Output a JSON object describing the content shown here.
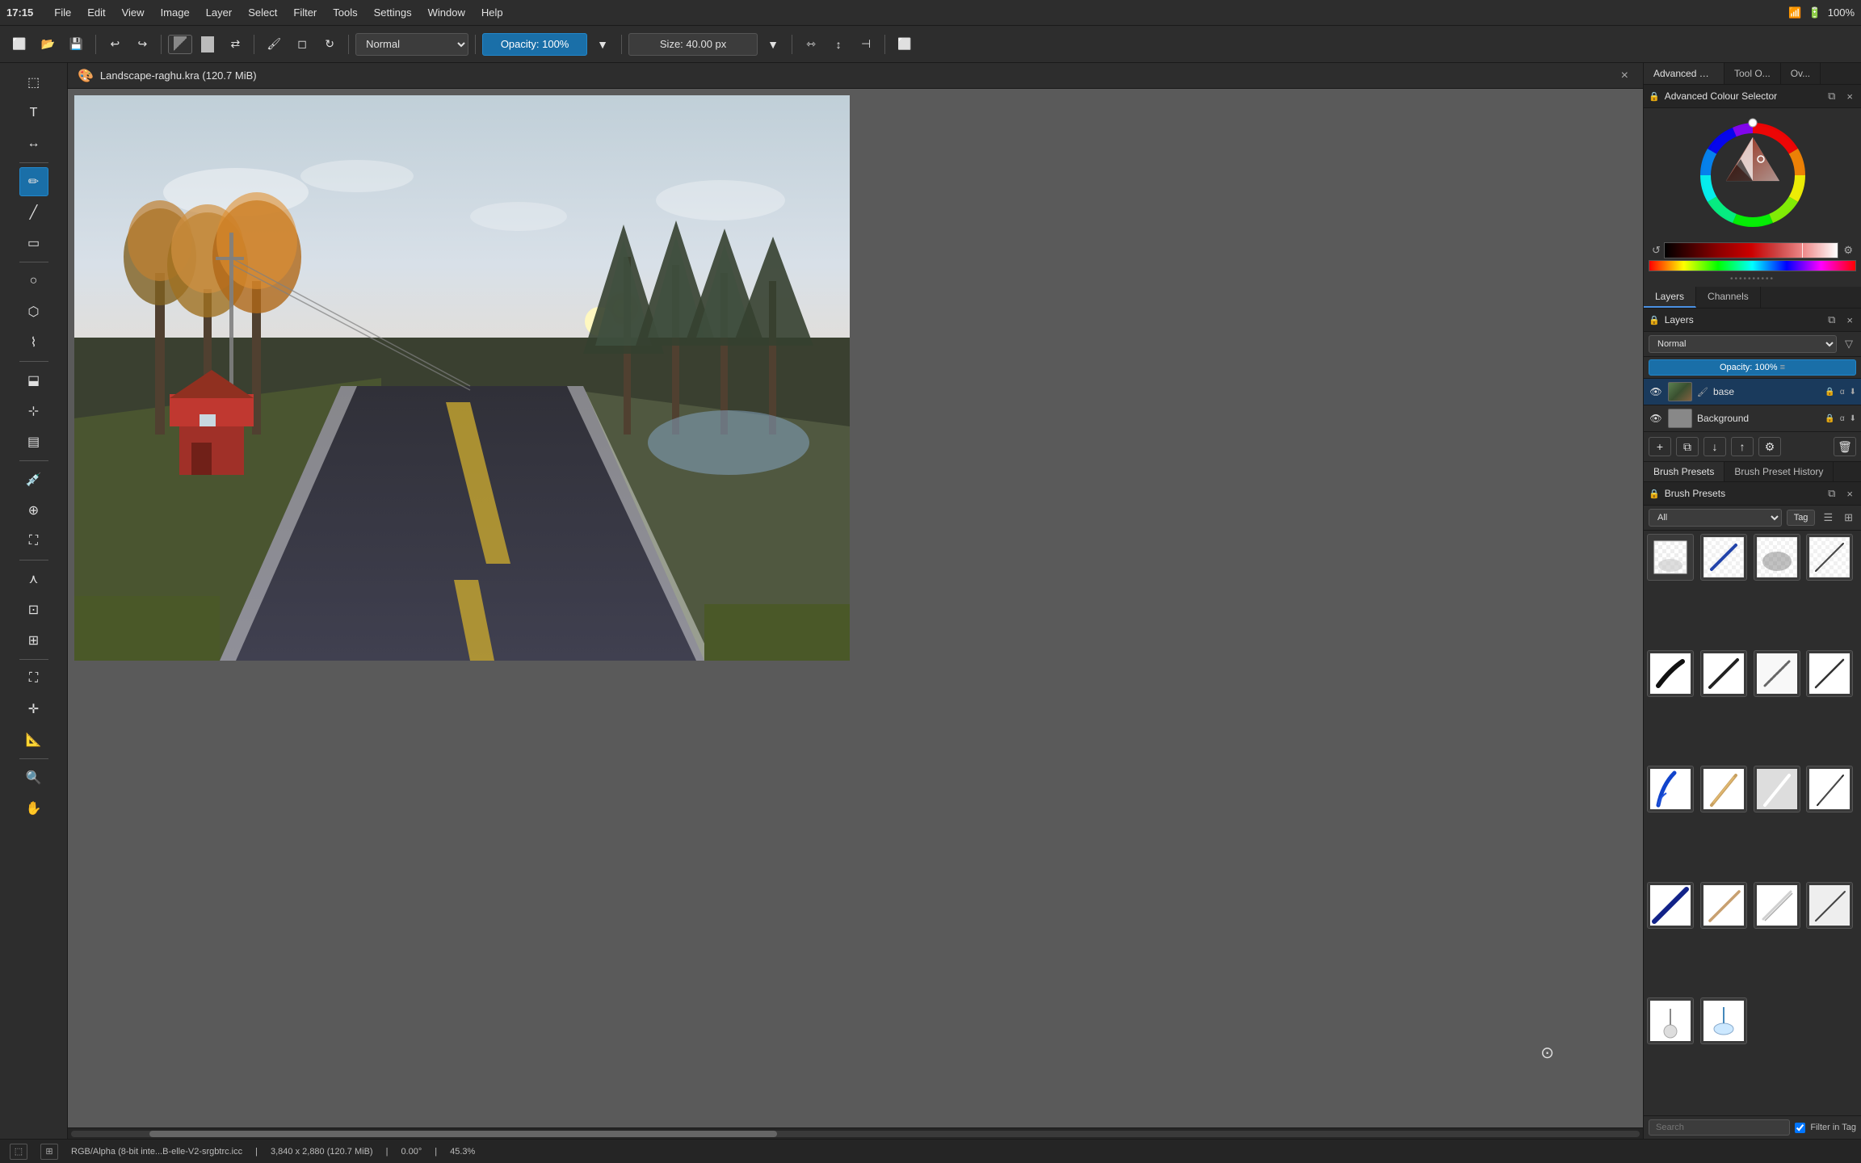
{
  "menubar": {
    "time": "17:15",
    "items": [
      "File",
      "Edit",
      "View",
      "Image",
      "Layer",
      "Select",
      "Filter",
      "Tools",
      "Settings",
      "Window",
      "Help"
    ],
    "battery": "100%"
  },
  "toolbar": {
    "blend_mode": "Normal",
    "opacity_label": "Opacity: 100%",
    "size_label": "Size: 40.00 px"
  },
  "canvas": {
    "title": "Landscape-raghu.kra (120.7 MiB)",
    "close_btn": "×"
  },
  "colour_selector": {
    "title": "Advanced Colour Selector",
    "tab1": "Advanced Colour Se...",
    "tab2": "Tool O...",
    "tab3": "Ov..."
  },
  "layers": {
    "title": "Layers",
    "tab_layers": "Layers",
    "tab_channels": "Channels",
    "blend_mode": "Normal",
    "opacity": "Opacity:  100%",
    "layer1_name": "base",
    "layer2_name": "Background"
  },
  "brush_presets": {
    "title": "Brush Presets",
    "tab1": "Brush Presets",
    "tab2": "Brush Preset History",
    "category": "All",
    "tag_btn": "Tag",
    "search_placeholder": "Search",
    "filter_in_tag": "Filter in Tag"
  },
  "status_bar": {
    "color_mode": "RGB/Alpha (8-bit inte...B-elle-V2-srgbtrc.icc",
    "dimensions": "3,840 x 2,880 (120.7 MiB)",
    "angle": "0.00°",
    "zoom": "45.3%"
  },
  "tools": {
    "icons": [
      "select-rect",
      "text",
      "transform",
      "brush",
      "line",
      "rect-shape",
      "ellipse",
      "polygon",
      "path",
      "fill",
      "contiguous-fill",
      "gradient",
      "eyedropper",
      "smart-patch",
      "vector-select",
      "freeform-select",
      "contiguous-select",
      "similar-select",
      "crop",
      "move",
      "transform-tool",
      "measure",
      "ruler",
      "color-picker",
      "zoom",
      "pan"
    ]
  },
  "brushes": [
    {
      "type": "eraser-soft"
    },
    {
      "type": "pen-blue"
    },
    {
      "type": "airbrush-grey"
    },
    {
      "type": "pen-sharp"
    },
    {
      "type": "brush-black-1"
    },
    {
      "type": "brush-black-2"
    },
    {
      "type": "brush-grey-1"
    },
    {
      "type": "brush-grey-2"
    },
    {
      "type": "pen-blue-2"
    },
    {
      "type": "pencil-beige"
    },
    {
      "type": "pencil-white"
    },
    {
      "type": "pencil-dark"
    },
    {
      "type": "brush-bottom-1"
    },
    {
      "type": "brush-bottom-2"
    },
    {
      "type": "brush-bottom-3"
    },
    {
      "type": "brush-bottom-4"
    }
  ]
}
